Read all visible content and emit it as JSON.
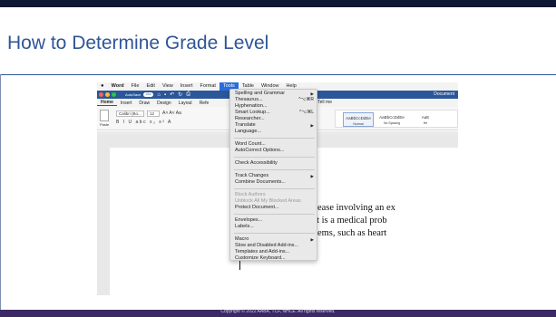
{
  "slide": {
    "title": "How to Determine Grade Level",
    "copyright": "Copyright © 2022 AABA, TCF, NHCE. All rights reserved."
  },
  "word": {
    "menubar": [
      "Word",
      "File",
      "Edit",
      "View",
      "Insert",
      "Format",
      "Tools",
      "Table",
      "Window",
      "Help"
    ],
    "autosave_label": "AutoSave",
    "autosave_state": "OFF",
    "doc_title": "Document",
    "tabs": [
      "Home",
      "Insert",
      "Draw",
      "Design",
      "Layout",
      "Refe"
    ],
    "tell_me": "Tell me",
    "ribbon": {
      "paste": "Paste",
      "font": "Calibri (Bo...",
      "size": "12",
      "styles": [
        {
          "sample": "AaBbCcDdEe",
          "label": "Normal"
        },
        {
          "sample": "AaBbCcDdEe",
          "label": "No Spacing"
        },
        {
          "sample": "AaE",
          "label": "He"
        }
      ]
    },
    "doc_lines": [
      "plex disease involving an ex",
      "ncern. It is a medical prob",
      "th problems, such as heart"
    ]
  },
  "tools_menu": {
    "group1": [
      {
        "label": "Spelling and Grammar",
        "submenu": true
      },
      {
        "label": "Thesaurus...",
        "shortcut": "^⌥⌘R"
      },
      {
        "label": "Hyphenation..."
      },
      {
        "label": "Smart Lookup...",
        "shortcut": "^⌥⌘L"
      },
      {
        "label": "Researcher..."
      },
      {
        "label": "Translate",
        "submenu": true
      },
      {
        "label": "Language..."
      }
    ],
    "group2": [
      {
        "label": "Word Count..."
      },
      {
        "label": "AutoCorrect Options..."
      }
    ],
    "group3": [
      {
        "label": "Check Accessibility"
      }
    ],
    "group4": [
      {
        "label": "Track Changes",
        "submenu": true
      },
      {
        "label": "Combine Documents..."
      }
    ],
    "group5": [
      {
        "label": "Block Authors"
      },
      {
        "label": "Unblock All My Blocked Areas"
      },
      {
        "label": "Protect Document..."
      }
    ],
    "group6": [
      {
        "label": "Envelopes..."
      },
      {
        "label": "Labels..."
      }
    ],
    "group7": [
      {
        "label": "Macro",
        "submenu": true
      },
      {
        "label": "Slow and Disabled Add-ins..."
      },
      {
        "label": "Templates and Add-ins..."
      },
      {
        "label": "Customize Keyboard..."
      }
    ]
  },
  "colors": {
    "title": "#2f5597",
    "word_blue": "#2b579a",
    "menu_highlight": "#2a6ddb",
    "footer": "#3b2a63"
  }
}
